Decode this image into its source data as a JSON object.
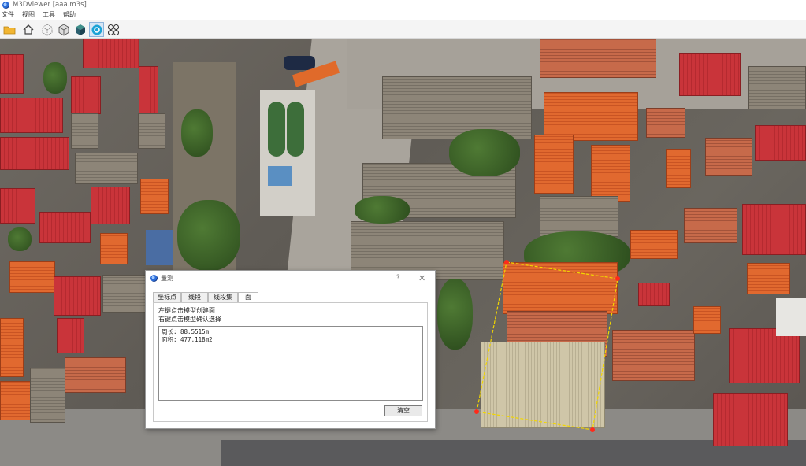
{
  "window": {
    "title": "M3DViewer [aaa.m3s]"
  },
  "menu": {
    "items": [
      "文件",
      "视图",
      "工具",
      "帮助"
    ]
  },
  "toolbar": {
    "buttons": [
      {
        "icon": "folder-open-icon"
      },
      {
        "icon": "home-icon"
      },
      {
        "icon": "grid-cube-icon"
      },
      {
        "icon": "wireframe-cube-icon"
      },
      {
        "icon": "solid-cube-icon"
      },
      {
        "icon": "target-circle-icon"
      },
      {
        "icon": "four-circles-icon"
      }
    ]
  },
  "colors": {
    "measure_line": "#f2d600",
    "measure_point": "#ff2a1a",
    "accent": "#2b6bd6"
  },
  "dialog": {
    "title": "量测",
    "help": "?",
    "close": "✕",
    "tabs": [
      {
        "label": "坐标点",
        "active": false
      },
      {
        "label": "线段",
        "active": false
      },
      {
        "label": "线段集",
        "active": false
      },
      {
        "label": "面",
        "active": true
      }
    ],
    "hint_line_1": "左键点击模型创建面",
    "hint_line_2": "右键点击模型确认选择",
    "result": {
      "perimeter": "周长: 88.5515m",
      "area": "面积: 477.118m2"
    },
    "clear_button": "清空"
  }
}
